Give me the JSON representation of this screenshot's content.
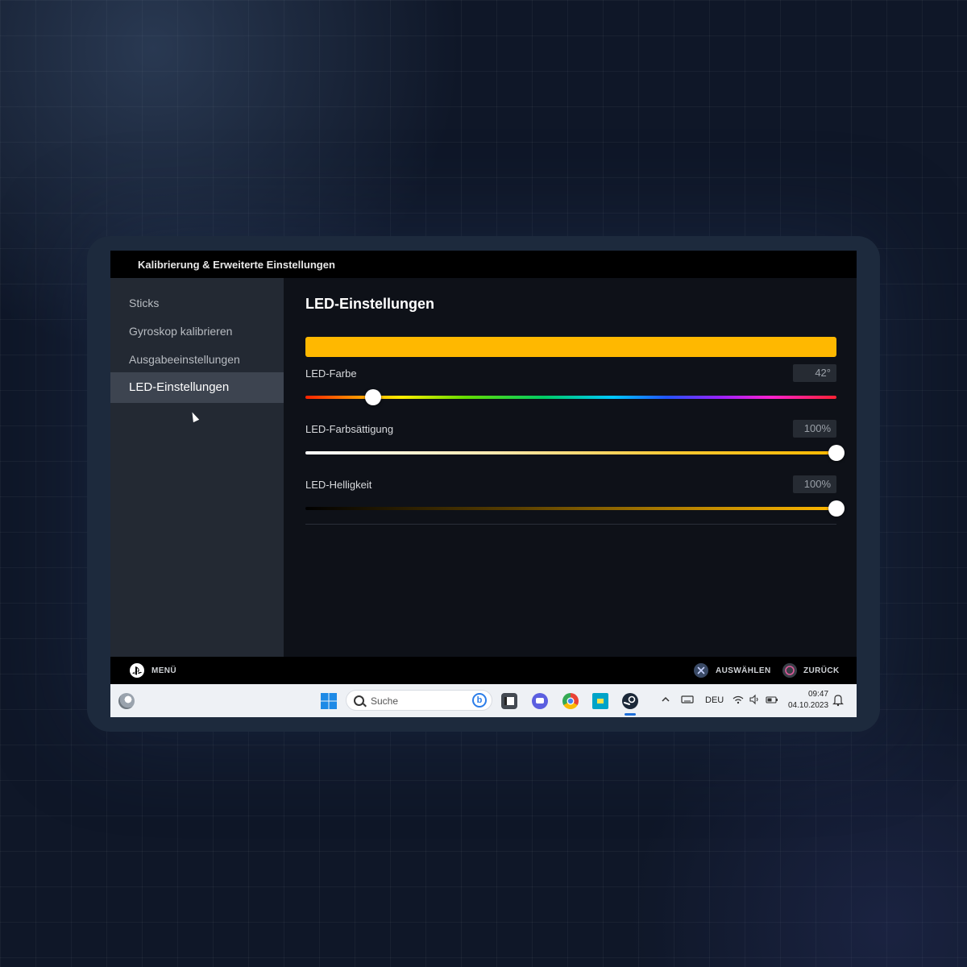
{
  "window": {
    "title": "Kalibrierung & Erweiterte Einstellungen"
  },
  "sidebar": {
    "items": [
      {
        "label": "Sticks",
        "active": false
      },
      {
        "label": "Gyroskop kalibrieren",
        "active": false
      },
      {
        "label": "Ausgabeeinstellungen",
        "active": false
      },
      {
        "label": "LED-Einstellungen",
        "active": true
      }
    ]
  },
  "content": {
    "heading": "LED-Einstellungen",
    "preview_color": "#ffb800",
    "sliders": [
      {
        "label": "LED-Farbe",
        "value_text": "42°",
        "fraction": 0.128
      },
      {
        "label": "LED-Farbsättigung",
        "value_text": "100%",
        "fraction": 1.0
      },
      {
        "label": "LED-Helligkeit",
        "value_text": "100%",
        "fraction": 1.0
      }
    ]
  },
  "footer": {
    "menu_label": "MENÜ",
    "select_label": "AUSWÄHLEN",
    "back_label": "ZURÜCK"
  },
  "taskbar": {
    "search_placeholder": "Suche",
    "language": "DEU",
    "time": "09:47",
    "date": "04.10.2023"
  },
  "colors": {
    "accent": "#ffb800",
    "cross_button": "#3a4a66",
    "circle_button": "#e05a9a"
  }
}
